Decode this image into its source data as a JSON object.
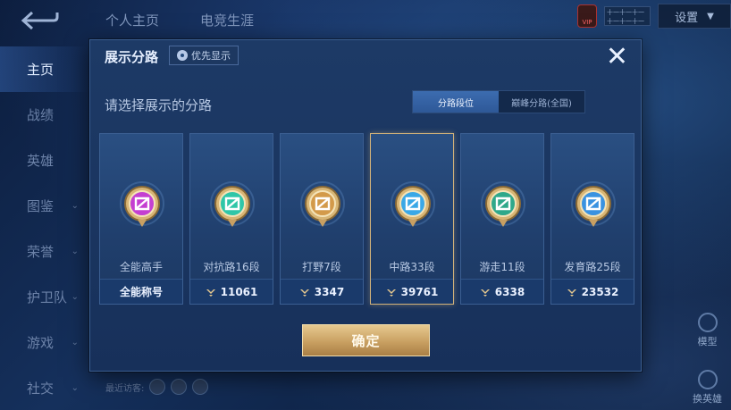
{
  "header": {
    "tabs": [
      "个人主页",
      "电竞生涯"
    ],
    "settings_label": "设置",
    "vip_label": "VIP",
    "notice_text": "十一十一十一十一十一十一"
  },
  "left_nav": [
    {
      "label": "主页",
      "active": true,
      "chevron": false
    },
    {
      "label": "战绩",
      "active": false,
      "chevron": false
    },
    {
      "label": "英雄",
      "active": false,
      "chevron": false
    },
    {
      "label": "图鉴",
      "active": false,
      "chevron": true
    },
    {
      "label": "荣誉",
      "active": false,
      "chevron": true
    },
    {
      "label": "护卫队",
      "active": false,
      "chevron": true
    },
    {
      "label": "游戏",
      "active": false,
      "chevron": true
    },
    {
      "label": "社交",
      "active": false,
      "chevron": true
    }
  ],
  "right_side": {
    "model_label": "模型",
    "swap_hero_label": "换英雄"
  },
  "bottom_bar": {
    "recent_visitors_label": "最近访客:"
  },
  "modal": {
    "title": "展示分路",
    "pref_button_label": "优先显示",
    "close_icon": "close-icon",
    "subtitle": "请选择展示的分路",
    "toggle": {
      "options": [
        "分路段位",
        "巅峰分路(全国)"
      ],
      "selected_index": 0
    },
    "cards": [
      {
        "name": "全能高手",
        "footer": "全能称号",
        "has_points": false,
        "color": "#c43fd1",
        "selected": false
      },
      {
        "name": "对抗路16段",
        "footer": "11061",
        "has_points": true,
        "color": "#2fc6a8",
        "selected": false
      },
      {
        "name": "打野7段",
        "footer": "3347",
        "has_points": true,
        "color": "#d39a4a",
        "selected": false
      },
      {
        "name": "中路33段",
        "footer": "39761",
        "has_points": true,
        "color": "#3aa8e6",
        "selected": true
      },
      {
        "name": "游走11段",
        "footer": "6338",
        "has_points": true,
        "color": "#2fa88a",
        "selected": false
      },
      {
        "name": "发育路25段",
        "footer": "23532",
        "has_points": true,
        "color": "#3a92e0",
        "selected": false
      }
    ],
    "confirm_label": "确定"
  }
}
